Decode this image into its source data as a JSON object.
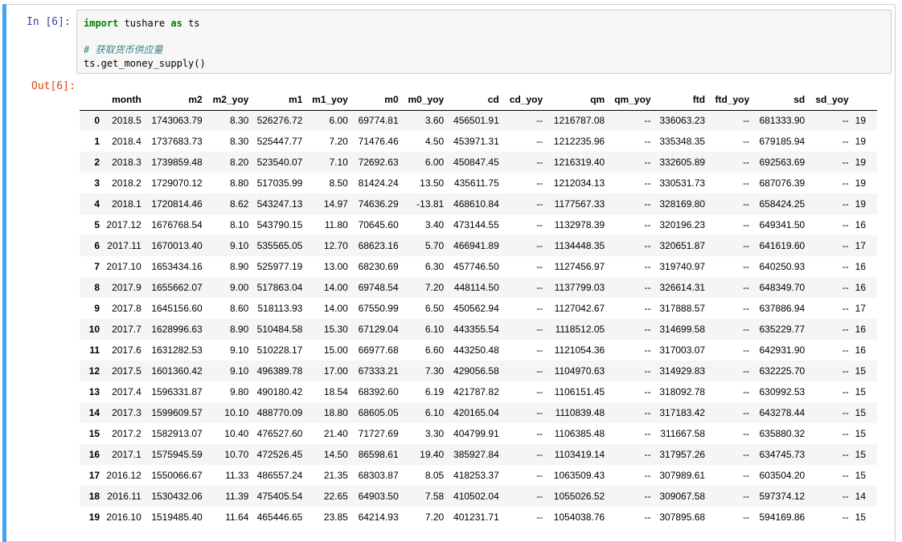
{
  "input_prompt": "In  [6]:",
  "output_prompt": "Out[6]:",
  "code": {
    "line1": {
      "kw1": "import",
      "mid": " tushare ",
      "kw2": "as",
      "end": " ts"
    },
    "comment": "# 获取货币供应量",
    "line3": {
      "call": "ts.get_money_supply",
      "paren": "()"
    }
  },
  "table": {
    "columns": [
      "",
      "month",
      "m2",
      "m2_yoy",
      "m1",
      "m1_yoy",
      "m0",
      "m0_yoy",
      "cd",
      "cd_yoy",
      "qm",
      "qm_yoy",
      "ftd",
      "ftd_yoy",
      "sd",
      "sd_yoy",
      ""
    ],
    "rows": [
      [
        "0",
        "2018.5",
        "1743063.79",
        "8.30",
        "526276.72",
        "6.00",
        "69774.81",
        "3.60",
        "456501.91",
        "--",
        "1216787.08",
        "--",
        "336063.23",
        "--",
        "681333.90",
        "--",
        "19"
      ],
      [
        "1",
        "2018.4",
        "1737683.73",
        "8.30",
        "525447.77",
        "7.20",
        "71476.46",
        "4.50",
        "453971.31",
        "--",
        "1212235.96",
        "--",
        "335348.35",
        "--",
        "679185.94",
        "--",
        "19"
      ],
      [
        "2",
        "2018.3",
        "1739859.48",
        "8.20",
        "523540.07",
        "7.10",
        "72692.63",
        "6.00",
        "450847.45",
        "--",
        "1216319.40",
        "--",
        "332605.89",
        "--",
        "692563.69",
        "--",
        "19"
      ],
      [
        "3",
        "2018.2",
        "1729070.12",
        "8.80",
        "517035.99",
        "8.50",
        "81424.24",
        "13.50",
        "435611.75",
        "--",
        "1212034.13",
        "--",
        "330531.73",
        "--",
        "687076.39",
        "--",
        "19"
      ],
      [
        "4",
        "2018.1",
        "1720814.46",
        "8.62",
        "543247.13",
        "14.97",
        "74636.29",
        "-13.81",
        "468610.84",
        "--",
        "1177567.33",
        "--",
        "328169.80",
        "--",
        "658424.25",
        "--",
        "19"
      ],
      [
        "5",
        "2017.12",
        "1676768.54",
        "8.10",
        "543790.15",
        "11.80",
        "70645.60",
        "3.40",
        "473144.55",
        "--",
        "1132978.39",
        "--",
        "320196.23",
        "--",
        "649341.50",
        "--",
        "16"
      ],
      [
        "6",
        "2017.11",
        "1670013.40",
        "9.10",
        "535565.05",
        "12.70",
        "68623.16",
        "5.70",
        "466941.89",
        "--",
        "1134448.35",
        "--",
        "320651.87",
        "--",
        "641619.60",
        "--",
        "17"
      ],
      [
        "7",
        "2017.10",
        "1653434.16",
        "8.90",
        "525977.19",
        "13.00",
        "68230.69",
        "6.30",
        "457746.50",
        "--",
        "1127456.97",
        "--",
        "319740.97",
        "--",
        "640250.93",
        "--",
        "16"
      ],
      [
        "8",
        "2017.9",
        "1655662.07",
        "9.00",
        "517863.04",
        "14.00",
        "69748.54",
        "7.20",
        "448114.50",
        "--",
        "1137799.03",
        "--",
        "326614.31",
        "--",
        "648349.70",
        "--",
        "16"
      ],
      [
        "9",
        "2017.8",
        "1645156.60",
        "8.60",
        "518113.93",
        "14.00",
        "67550.99",
        "6.50",
        "450562.94",
        "--",
        "1127042.67",
        "--",
        "317888.57",
        "--",
        "637886.94",
        "--",
        "17"
      ],
      [
        "10",
        "2017.7",
        "1628996.63",
        "8.90",
        "510484.58",
        "15.30",
        "67129.04",
        "6.10",
        "443355.54",
        "--",
        "1118512.05",
        "--",
        "314699.58",
        "--",
        "635229.77",
        "--",
        "16"
      ],
      [
        "11",
        "2017.6",
        "1631282.53",
        "9.10",
        "510228.17",
        "15.00",
        "66977.68",
        "6.60",
        "443250.48",
        "--",
        "1121054.36",
        "--",
        "317003.07",
        "--",
        "642931.90",
        "--",
        "16"
      ],
      [
        "12",
        "2017.5",
        "1601360.42",
        "9.10",
        "496389.78",
        "17.00",
        "67333.21",
        "7.30",
        "429056.58",
        "--",
        "1104970.63",
        "--",
        "314929.83",
        "--",
        "632225.70",
        "--",
        "15"
      ],
      [
        "13",
        "2017.4",
        "1596331.87",
        "9.80",
        "490180.42",
        "18.54",
        "68392.60",
        "6.19",
        "421787.82",
        "--",
        "1106151.45",
        "--",
        "318092.78",
        "--",
        "630992.53",
        "--",
        "15"
      ],
      [
        "14",
        "2017.3",
        "1599609.57",
        "10.10",
        "488770.09",
        "18.80",
        "68605.05",
        "6.10",
        "420165.04",
        "--",
        "1110839.48",
        "--",
        "317183.42",
        "--",
        "643278.44",
        "--",
        "15"
      ],
      [
        "15",
        "2017.2",
        "1582913.07",
        "10.40",
        "476527.60",
        "21.40",
        "71727.69",
        "3.30",
        "404799.91",
        "--",
        "1106385.48",
        "--",
        "311667.58",
        "--",
        "635880.32",
        "--",
        "15"
      ],
      [
        "16",
        "2017.1",
        "1575945.59",
        "10.70",
        "472526.45",
        "14.50",
        "86598.61",
        "19.40",
        "385927.84",
        "--",
        "1103419.14",
        "--",
        "317957.26",
        "--",
        "634745.73",
        "--",
        "15"
      ],
      [
        "17",
        "2016.12",
        "1550066.67",
        "11.33",
        "486557.24",
        "21.35",
        "68303.87",
        "8.05",
        "418253.37",
        "--",
        "1063509.43",
        "--",
        "307989.61",
        "--",
        "603504.20",
        "--",
        "15"
      ],
      [
        "18",
        "2016.11",
        "1530432.06",
        "11.39",
        "475405.54",
        "22.65",
        "64903.50",
        "7.58",
        "410502.04",
        "--",
        "1055026.52",
        "--",
        "309067.58",
        "--",
        "597374.12",
        "--",
        "14"
      ],
      [
        "19",
        "2016.10",
        "1519485.40",
        "11.64",
        "465446.65",
        "23.85",
        "64214.93",
        "7.20",
        "401231.71",
        "--",
        "1054038.76",
        "--",
        "307895.68",
        "--",
        "594169.86",
        "--",
        "15"
      ]
    ]
  }
}
